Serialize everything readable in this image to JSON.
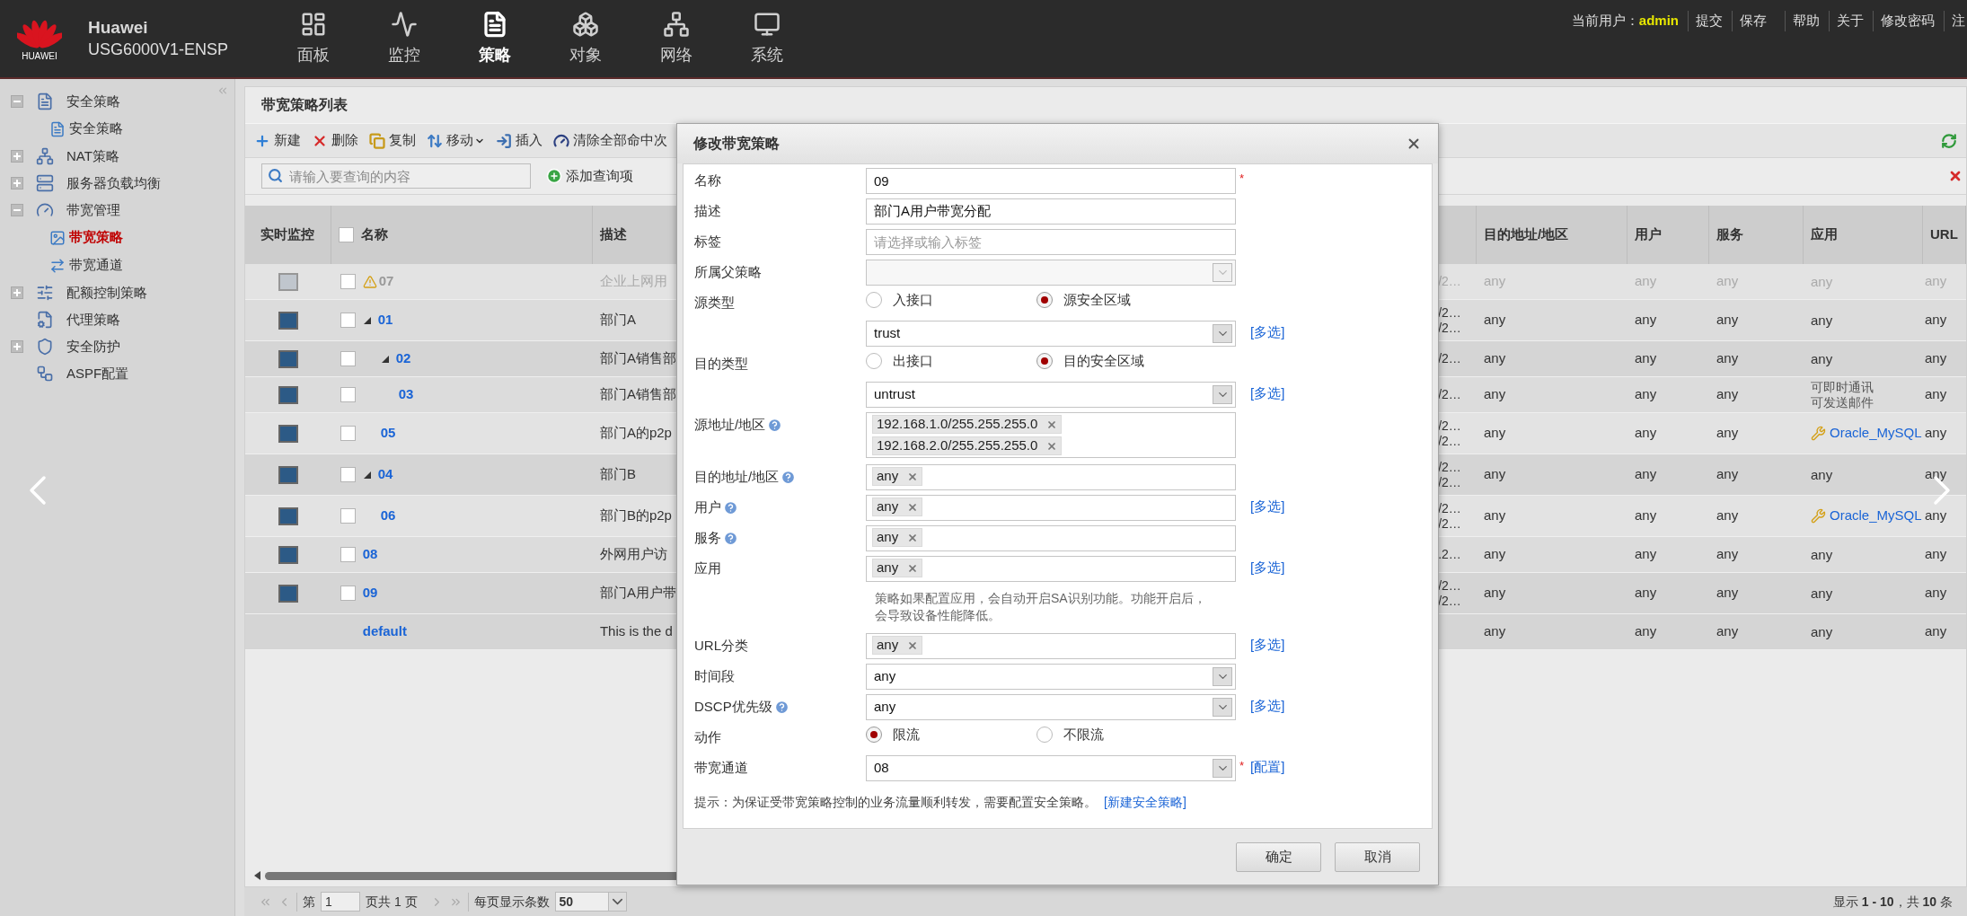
{
  "header": {
    "logo_text": "HUAWEI",
    "brand": "Huawei",
    "model": "USG6000V1-ENSP",
    "nav": [
      {
        "label": "面板",
        "selected": false
      },
      {
        "label": "监控",
        "selected": false
      },
      {
        "label": "策略",
        "selected": true
      },
      {
        "label": "对象",
        "selected": false
      },
      {
        "label": "网络",
        "selected": false
      },
      {
        "label": "系统",
        "selected": false
      }
    ],
    "user_label": "当前用户：",
    "user": "admin",
    "links": [
      "提交",
      "保存",
      "帮助",
      "关于",
      "修改密码",
      "注"
    ]
  },
  "sidebar": {
    "items": [
      {
        "label": "安全策略",
        "expanded": true,
        "selected": false,
        "children": [
          {
            "label": "安全策略",
            "selected": false
          }
        ]
      },
      {
        "label": "NAT策略",
        "expanded": false,
        "selected": false
      },
      {
        "label": "服务器负载均衡",
        "expanded": false,
        "selected": false
      },
      {
        "label": "带宽管理",
        "expanded": true,
        "selected": false,
        "children": [
          {
            "label": "带宽策略",
            "selected": true
          },
          {
            "label": "带宽通道",
            "selected": false
          }
        ]
      },
      {
        "label": "配额控制策略",
        "expanded": false,
        "selected": false
      },
      {
        "label": "代理策略",
        "selected": false
      },
      {
        "label": "安全防护",
        "expanded": false,
        "selected": false
      },
      {
        "label": "ASPF配置",
        "selected": false
      }
    ]
  },
  "panel": {
    "title": "带宽策略列表",
    "toolbar": [
      {
        "label": "新建",
        "kind": "button"
      },
      {
        "label": "删除",
        "kind": "button"
      },
      {
        "label": "复制",
        "kind": "button"
      },
      {
        "label": "移动",
        "kind": "menu"
      },
      {
        "label": "插入",
        "kind": "button"
      },
      {
        "label": "清除全部命中次",
        "kind": "button"
      }
    ],
    "search": {
      "placeholder": "请输入要查询的内容"
    },
    "add_query": "添加查询项"
  },
  "table": {
    "columns": [
      "实时监控",
      "名称",
      "描述",
      "目的地址/地区",
      "用户",
      "服务",
      "应用",
      "URL"
    ],
    "header_checked": false,
    "rows": [
      {
        "name": "07",
        "kind": "policy",
        "checked": false,
        "disabled": true,
        "warning": true,
        "description": "企业上网用",
        "column_4": [
          "/2…"
        ],
        "destination": "any",
        "user": "any",
        "service": "any",
        "application": {
          "kind": "text",
          "lines": [
            "any"
          ]
        },
        "url": "any"
      },
      {
        "name": "01",
        "kind": "policy",
        "checked": false,
        "disabled": false,
        "warning": false,
        "expanded": true,
        "description": "部门A",
        "column_4": [
          "/2…",
          "/2…"
        ],
        "destination": "any",
        "user": "any",
        "service": "any",
        "application": {
          "kind": "text",
          "lines": [
            "any"
          ]
        },
        "url": "any",
        "children": [
          {
            "name": "02",
            "kind": "policy",
            "checked": false,
            "disabled": false,
            "warning": false,
            "expanded": true,
            "description": "部门A销售部",
            "column_4": [
              "/2…"
            ],
            "destination": "any",
            "user": "any",
            "service": "any",
            "application": {
              "kind": "text",
              "lines": [
                "any"
              ]
            },
            "url": "any",
            "children": [
              {
                "name": "03",
                "kind": "policy",
                "checked": false,
                "disabled": false,
                "warning": false,
                "description": "部门A销售部",
                "column_4": [
                  "/2…"
                ],
                "destination": "any",
                "user": "any",
                "service": "any",
                "application": {
                  "kind": "text",
                  "lines": [
                    "可即时通讯",
                    "可发送邮件"
                  ]
                },
                "url": "any"
              }
            ]
          },
          {
            "name": "05",
            "kind": "policy",
            "checked": false,
            "disabled": false,
            "warning": false,
            "description": "部门A的p2p",
            "column_4": [
              "/2…",
              "/2…"
            ],
            "destination": "any",
            "user": "any",
            "service": "any",
            "application": {
              "kind": "app",
              "name": "Oracle_MySQL"
            },
            "url": "any"
          }
        ]
      },
      {
        "name": "04",
        "kind": "policy",
        "checked": false,
        "disabled": false,
        "warning": false,
        "expanded": true,
        "description": "部门B",
        "column_4": [
          "/2…",
          "/2…"
        ],
        "destination": "any",
        "user": "any",
        "service": "any",
        "application": {
          "kind": "text",
          "lines": [
            "any"
          ]
        },
        "url": "any",
        "children": [
          {
            "name": "06",
            "kind": "policy",
            "checked": false,
            "disabled": false,
            "warning": false,
            "description": "部门B的p2p",
            "column_4": [
              "/2…",
              "/2…"
            ],
            "destination": "any",
            "user": "any",
            "service": "any",
            "application": {
              "kind": "app",
              "name": "Oracle_MySQL"
            },
            "url": "any"
          }
        ]
      },
      {
        "name": "08",
        "kind": "policy",
        "checked": false,
        "disabled": false,
        "warning": false,
        "description": "外网用户访",
        "column_4": [
          ".2…"
        ],
        "destination": "any",
        "user": "any",
        "service": "any",
        "application": {
          "kind": "text",
          "lines": [
            "any"
          ]
        },
        "url": "any"
      },
      {
        "name": "09",
        "kind": "policy",
        "checked": false,
        "disabled": false,
        "warning": false,
        "description": "部门A用户带",
        "column_4": [
          "/2…",
          "/2…"
        ],
        "destination": "any",
        "user": "any",
        "service": "any",
        "application": {
          "kind": "text",
          "lines": [
            "any"
          ]
        },
        "url": "any"
      },
      {
        "name": "default",
        "kind": "default",
        "disabled": false,
        "warning": false,
        "description": "This is the d",
        "destination": "any",
        "user": "any",
        "service": "any",
        "application": {
          "kind": "text",
          "lines": [
            "any"
          ]
        },
        "url": "any"
      }
    ]
  },
  "pager": {
    "page_label": "第",
    "page": "1",
    "page_total": "页共 1 页",
    "per_page_label": "每页显示条数",
    "per_page": "50",
    "summary": "显示 **1 - 10**，共 **10** 条"
  },
  "dialog": {
    "title": "修改带宽策略",
    "fields": [
      {
        "kind": "text",
        "label": "名称",
        "value": "09",
        "required_mark": "*"
      },
      {
        "kind": "text",
        "label": "描述",
        "value": "部门A用户带宽分配"
      },
      {
        "kind": "text",
        "label": "标签",
        "placeholder": "请选择或输入标签"
      },
      {
        "kind": "select",
        "label": "所属父策略",
        "disabled": true
      },
      {
        "kind": "radio",
        "label": "源类型",
        "options": [
          {
            "label": "入接口",
            "selected": false
          },
          {
            "label": "源安全区域",
            "selected": true
          }
        ]
      },
      {
        "kind": "select",
        "value": "trust",
        "disabled": false,
        "link": "[多选]"
      },
      {
        "kind": "radio",
        "label": "目的类型",
        "options": [
          {
            "label": "出接口",
            "selected": false
          },
          {
            "label": "目的安全区域",
            "selected": true
          }
        ]
      },
      {
        "kind": "select",
        "value": "untrust",
        "disabled": false,
        "link": "[多选]"
      },
      {
        "kind": "tags",
        "label": "源地址/地区",
        "help": true,
        "tags": [
          "192.168.1.0/255.255.255.0",
          "192.168.2.0/255.255.255.0"
        ]
      },
      {
        "kind": "tags",
        "label": "目的地址/地区",
        "help": true,
        "tags": [
          "any"
        ]
      },
      {
        "kind": "tags",
        "label": "用户",
        "help": true,
        "tags": [
          "any"
        ],
        "link": "[多选]"
      },
      {
        "kind": "tags",
        "label": "服务",
        "help": true,
        "tags": [
          "any"
        ]
      },
      {
        "kind": "tags",
        "label": "应用",
        "tags": [
          "any"
        ],
        "link": "[多选]"
      },
      {
        "kind": "note",
        "text": "策略如果配置应用，会自动开启SA识别功能。功能开启后，会导致设备性能降低。"
      },
      {
        "kind": "tags",
        "label": "URL分类",
        "tags": [
          "any"
        ],
        "link": "[多选]"
      },
      {
        "kind": "select",
        "label": "时间段",
        "value": "any",
        "disabled": false
      },
      {
        "kind": "select",
        "label": "DSCP优先级",
        "help": true,
        "value": "any",
        "disabled": false,
        "link": "[多选]"
      },
      {
        "kind": "radio",
        "label": "动作",
        "options": [
          {
            "label": "限流",
            "selected": true
          },
          {
            "label": "不限流",
            "selected": false
          }
        ]
      },
      {
        "kind": "select",
        "label": "带宽通道",
        "value": "08",
        "disabled": false,
        "required_mark": "*",
        "link": "[配置]"
      }
    ],
    "hint": "提示：为保证受带宽策略控制的业务流量顺利转发，需要配置安全策略。",
    "hint_link": "[新建安全策略]",
    "buttons": [
      "确定",
      "取消"
    ]
  }
}
